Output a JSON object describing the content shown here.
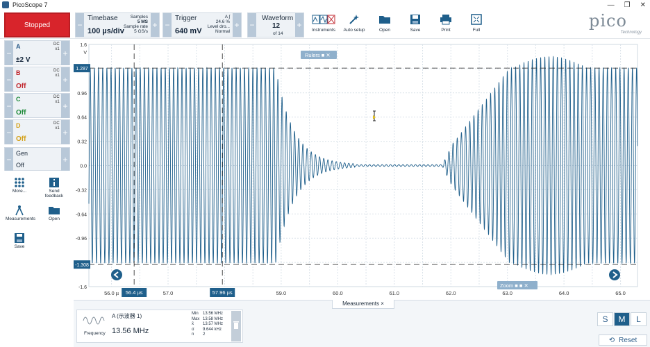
{
  "window": {
    "title": "PicoScope 7",
    "minimize": "—",
    "restore": "❐",
    "close": "✕"
  },
  "run": {
    "stopped_label": "Stopped"
  },
  "timebase": {
    "label": "Timebase",
    "value": "100 µs/div",
    "samples_label": "Samples",
    "samples_value": "5 MS",
    "rate_label": "Sample rate",
    "rate_value": "5 GS/s"
  },
  "trigger": {
    "label": "Trigger",
    "value": "640 mV",
    "channel": "A",
    "edge": "ʃ",
    "pct": "24.6 %",
    "level_label": "Level dro...",
    "mode": "Normal"
  },
  "waveform": {
    "label": "Waveform",
    "value": "12",
    "of": "of 14"
  },
  "tools": {
    "instruments": "Instruments",
    "autosetup": "Auto setup",
    "open": "Open",
    "save": "Save",
    "print": "Print",
    "full": "Full"
  },
  "logo": {
    "text": "pico",
    "sub": "Technology"
  },
  "channels": [
    {
      "name": "A",
      "coupling": "DC",
      "probe": "x1",
      "range": "±2 V",
      "color": "#2c5d8a"
    },
    {
      "name": "B",
      "coupling": "DC",
      "probe": "x1",
      "range": "Off",
      "color": "#c0262d"
    },
    {
      "name": "C",
      "coupling": "DC",
      "probe": "x1",
      "range": "Off",
      "color": "#1f8a3a"
    },
    {
      "name": "D",
      "coupling": "DC",
      "probe": "x1",
      "range": "Off",
      "color": "#d4a017"
    }
  ],
  "gen": {
    "name": "Gen",
    "state": "Off"
  },
  "left_tools": {
    "more": "More...",
    "feedback": "Send\nfeedback",
    "measurements": "Measurements",
    "open": "Open",
    "save": "Save"
  },
  "scope": {
    "rulers_label": "Rulers",
    "zoom_label": "Zoom",
    "ruler_top": "1.287",
    "ruler_bottom": "-1.308",
    "cursor_left": "56.4 µs",
    "cursor_right": "57.96 µs"
  },
  "chart_data": {
    "type": "line",
    "ylabel": "V",
    "ylim": [
      -1.6,
      1.6
    ],
    "yticks": [
      "1.6",
      "1.287",
      "0.96",
      "0.64",
      "0.32",
      "0.0",
      "-0.32",
      "-0.64",
      "-0.96",
      "-1.308",
      "-1.6"
    ],
    "xlim": [
      55.6,
      65.3
    ],
    "xticks": [
      "56.0 µ",
      "57.0",
      "58.0",
      "59.0",
      "60.0",
      "61.0",
      "62.0",
      "63.0",
      "64.0",
      "65.0"
    ],
    "series_color": "#1f5f8b"
  },
  "measurements": {
    "tab": "Measurements",
    "type": "Frequency",
    "channel": "A (示波器 1)",
    "value": "13.56 MHz",
    "stats": [
      {
        "k": "Min",
        "v": "13.56 MHz"
      },
      {
        "k": "Max",
        "v": "13.58 MHz"
      },
      {
        "k": "x̄",
        "v": "13.57 MHz"
      },
      {
        "k": "σ",
        "v": "9.644 kHz"
      },
      {
        "k": "n",
        "v": "2"
      }
    ]
  },
  "view": {
    "s": "S",
    "m": "M",
    "l": "L",
    "reset": "Reset"
  }
}
